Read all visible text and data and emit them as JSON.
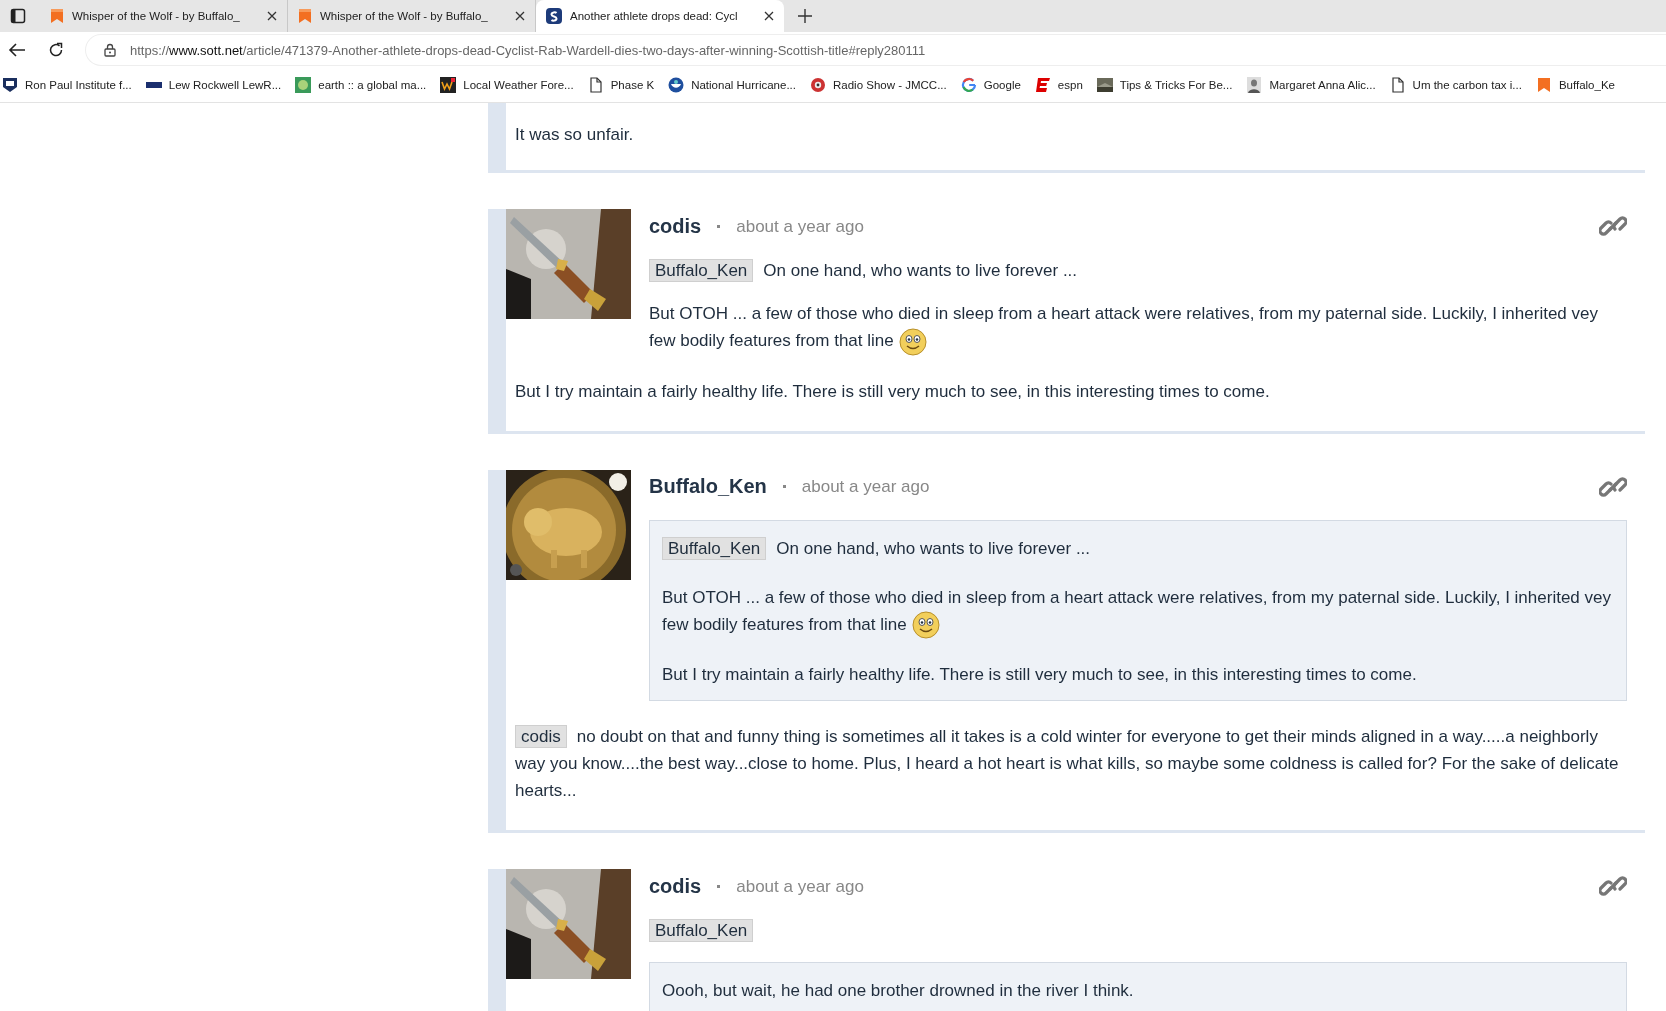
{
  "browser": {
    "tabs": [
      {
        "title": "Whisper of the Wolf - by Buffalo_",
        "selected": false
      },
      {
        "title": "Whisper of the Wolf - by Buffalo_",
        "selected": false
      },
      {
        "title": "Another athlete drops dead: Cycl",
        "selected": true
      }
    ],
    "url": {
      "scheme": "https://",
      "host": "www.sott.net",
      "path": "/article/471379-Another-athlete-drops-dead-Cyclist-Rab-Wardell-dies-two-days-after-winning-Scottish-title#reply280111"
    },
    "bookmarks": [
      "Ron Paul Institute f...",
      "Lew Rockwell LewR...",
      "earth :: a global ma...",
      "Local Weather Fore...",
      "Phase K",
      "National Hurricane...",
      "Radio Show - JMCC...",
      "Google",
      "espn",
      "Tips & Tricks For Be...",
      "Margaret Anna Alic...",
      "Um the carbon tax i...",
      "Buffalo_Ke"
    ]
  },
  "comments": [
    {
      "after": [
        {
          "kind": "para",
          "text": "It was so unfair."
        }
      ]
    },
    {
      "author": "codis",
      "time": "about a year ago",
      "body": [
        {
          "kind": "para",
          "mention": "Buffalo_Ken",
          "text": "On one hand, who wants to live forever ..."
        },
        {
          "kind": "para",
          "text": "But OTOH ... a few of those who died in sleep from a heart attack were relatives, from my paternal side. Luckily, I inherited vey few bodily features from that line",
          "emoticon": true
        }
      ],
      "after": [
        {
          "kind": "para",
          "text": "But I try maintain a fairly healthy life. There is still very much to see, in this interesting times to come."
        }
      ]
    },
    {
      "author": "Buffalo_Ken",
      "time": "about a year ago",
      "body": [
        {
          "kind": "quote",
          "blocks": [
            {
              "kind": "para",
              "mention": "Buffalo_Ken",
              "text": "On one hand, who wants to live forever ..."
            },
            {
              "kind": "para",
              "text": "But OTOH ... a few of those who died in sleep from a heart attack were relatives, from my paternal side. Luckily, I inherited vey few bodily features from that line",
              "emoticon": true
            },
            {
              "kind": "para",
              "text": "But I try maintain a fairly healthy life. There is still very much to see, in this interesting times to come."
            }
          ]
        }
      ],
      "after": [
        {
          "kind": "para",
          "mention": "codis",
          "text": "no doubt on that and funny thing is sometimes all it takes is a cold winter for everyone to get their minds aligned in a way.....a neighborly way you know....the best way...close to home. Plus, I heard a hot heart is what kills, so maybe some coldness is called for? For the sake of delicate hearts..."
        }
      ]
    },
    {
      "author": "codis",
      "time": "about a year ago",
      "body": [
        {
          "kind": "para",
          "mention": "Buffalo_Ken"
        },
        {
          "kind": "quote",
          "blocks": [
            {
              "kind": "para",
              "text": "Oooh, but wait, he had one brother drowned in the river I think."
            }
          ]
        }
      ]
    }
  ]
}
